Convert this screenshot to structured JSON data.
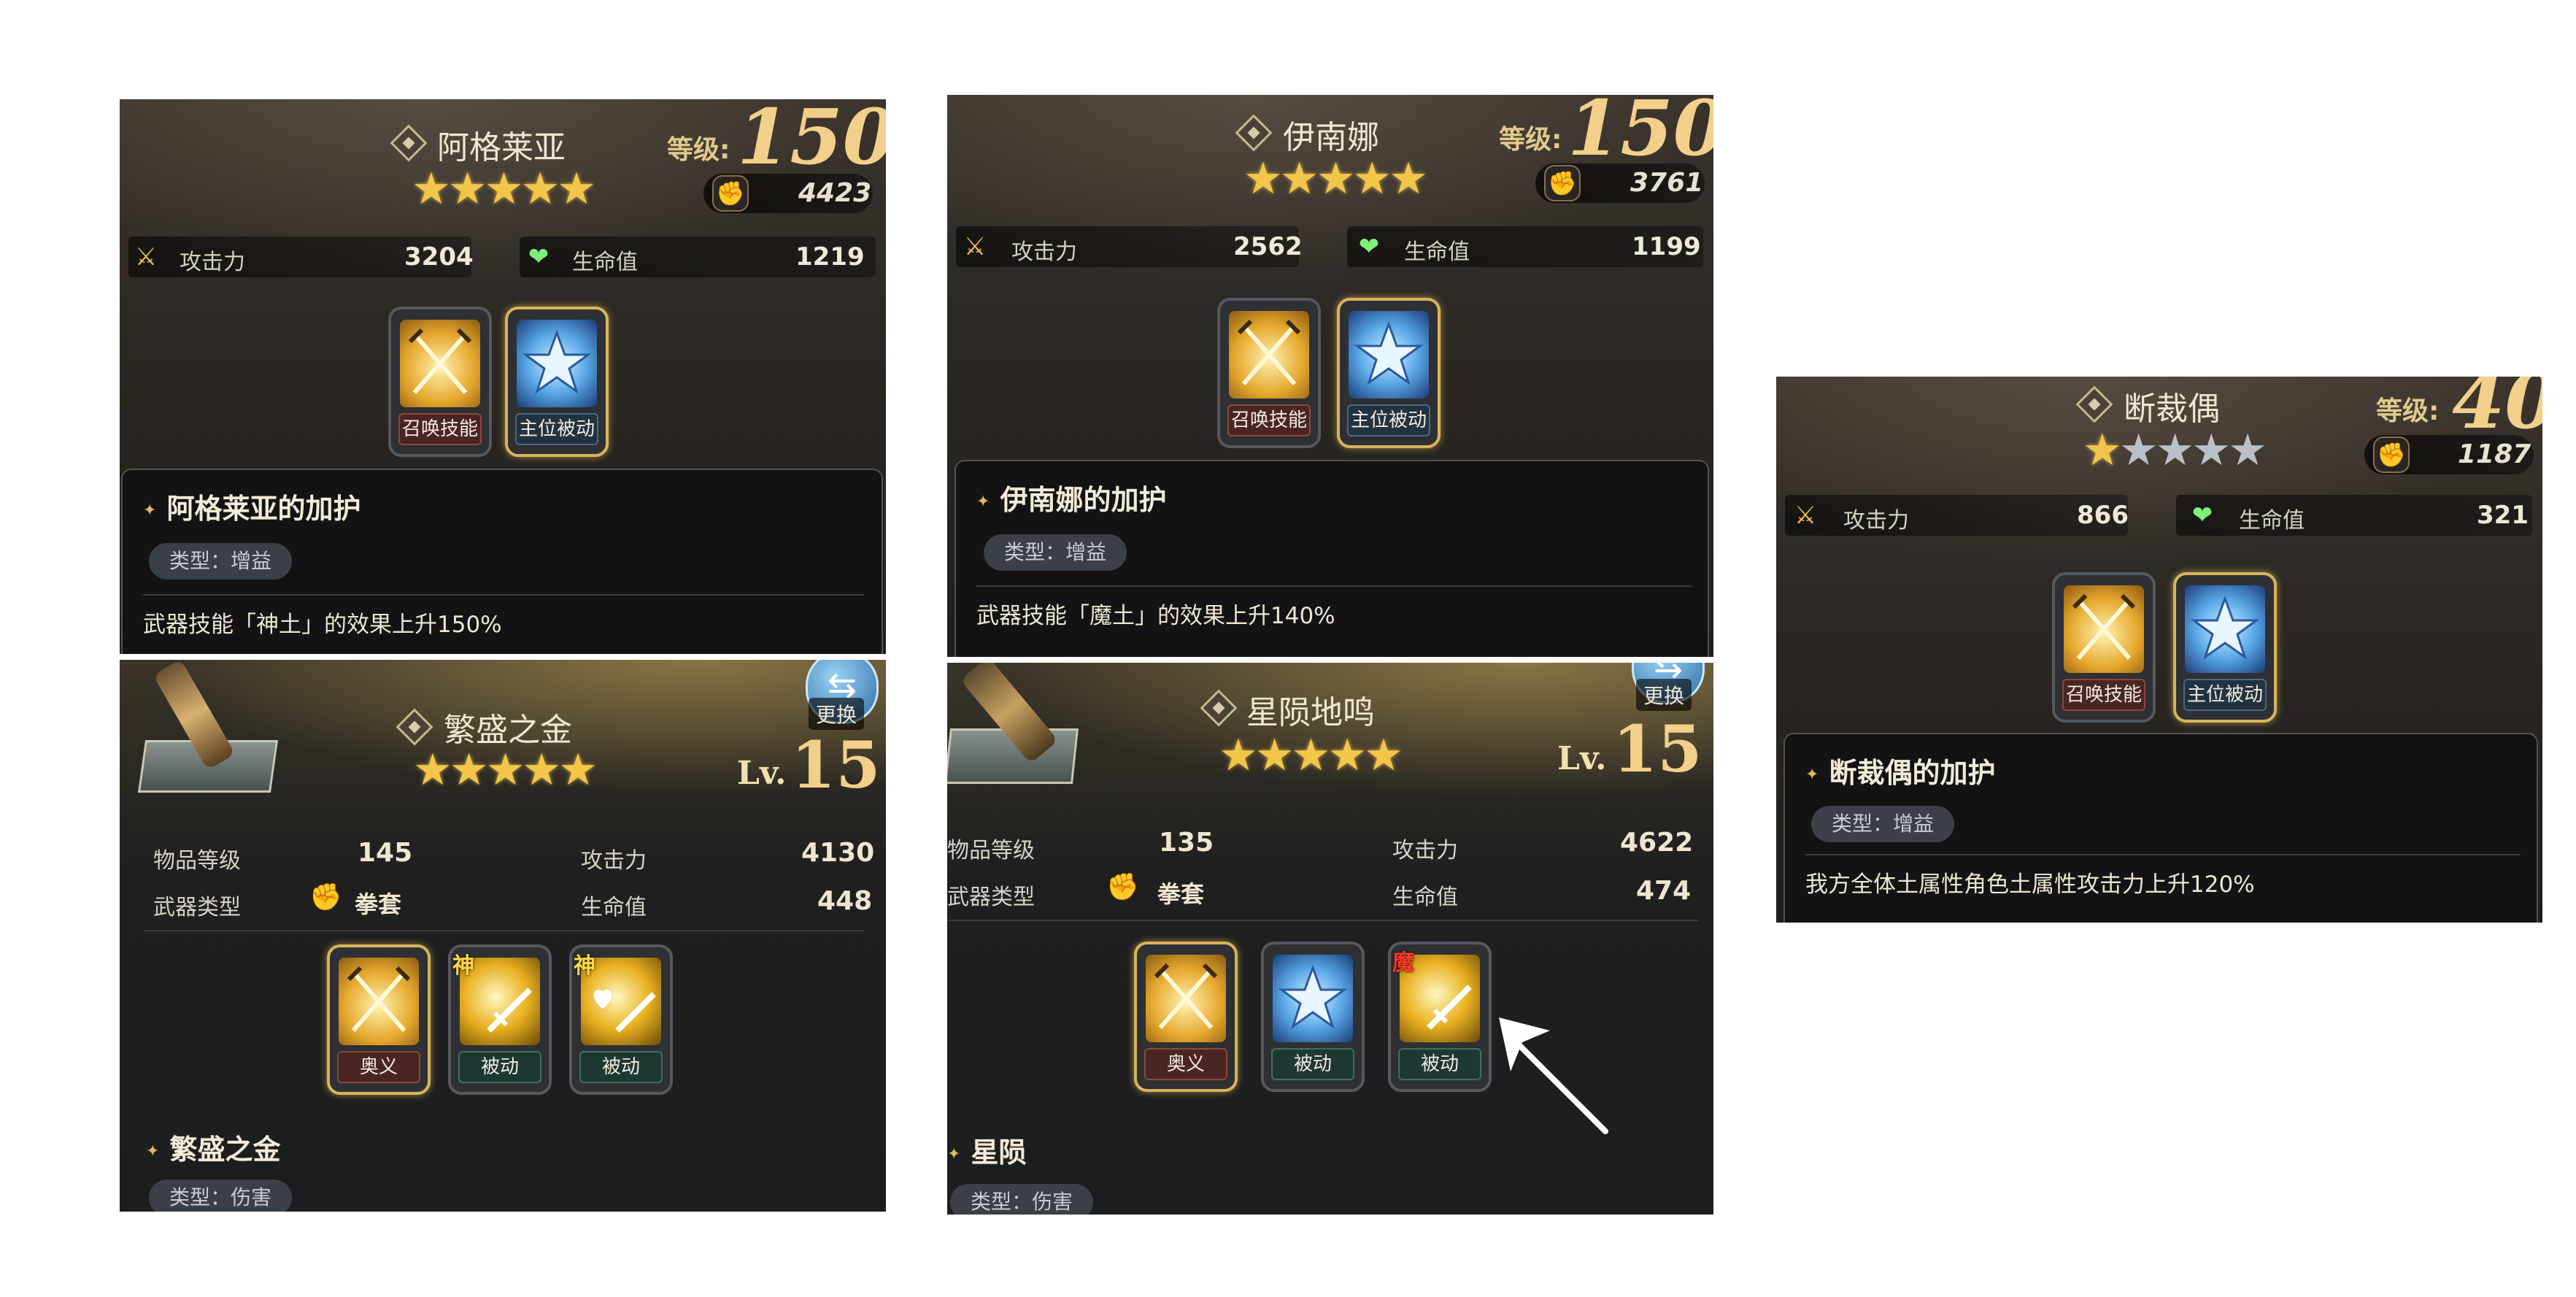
{
  "characters": [
    {
      "name": "阿格莱亚",
      "stars": 5,
      "level_label": "等级:",
      "level": "150",
      "power": "4423",
      "atk_label": "攻击力",
      "atk": "3204",
      "hp_label": "生命值",
      "hp": "1219",
      "skills": [
        {
          "label": "召唤技能",
          "icon": "crossed-swords-icon"
        },
        {
          "label": "主位被动",
          "icon": "star-emblem-icon"
        }
      ],
      "buff_title": "阿格莱亚的加护",
      "buff_type": "类型：增益",
      "buff_desc": "武器技能「神土」的效果上升150%"
    },
    {
      "name": "伊南娜",
      "stars": 5,
      "level_label": "等级:",
      "level": "150",
      "power": "3761",
      "atk_label": "攻击力",
      "atk": "2562",
      "hp_label": "生命值",
      "hp": "1199",
      "skills": [
        {
          "label": "召唤技能",
          "icon": "crossed-swords-icon"
        },
        {
          "label": "主位被动",
          "icon": "star-emblem-icon"
        }
      ],
      "buff_title": "伊南娜的加护",
      "buff_type": "类型：增益",
      "buff_desc": "武器技能「魔土」的效果上升140%"
    },
    {
      "name": "断裁偶",
      "stars": 1,
      "level_label": "等级:",
      "level": "40",
      "power": "1187",
      "atk_label": "攻击力",
      "atk": "866",
      "hp_label": "生命值",
      "hp": "321",
      "skills": [
        {
          "label": "召唤技能",
          "icon": "crossed-swords-icon"
        },
        {
          "label": "主位被动",
          "icon": "star-emblem-icon"
        }
      ],
      "buff_title": "断裁偶的加护",
      "buff_type": "类型：增益",
      "buff_desc": "我方全体土属性角色土属性攻击力上升120%"
    }
  ],
  "weapons": [
    {
      "name": "繁盛之金",
      "stars": 5,
      "swap_label": "更换",
      "lv_prefix": "Lv.",
      "lv": "15",
      "item_level_label": "物品等级",
      "item_level": "145",
      "atk_label": "攻击力",
      "atk": "4130",
      "type_label": "武器类型",
      "type": "拳套",
      "hp_label": "生命值",
      "hp": "448",
      "skills": [
        {
          "label": "奥义",
          "tag": ""
        },
        {
          "label": "被动",
          "tag": "神"
        },
        {
          "label": "被动",
          "tag": "神"
        }
      ],
      "title": "繁盛之金",
      "type_pill": "类型：伤害"
    },
    {
      "name": "星陨地鸣",
      "stars": 5,
      "swap_label": "更换",
      "lv_prefix": "Lv.",
      "lv": "15",
      "item_level_label": "物品等级",
      "item_level": "135",
      "atk_label": "攻击力",
      "atk": "4622",
      "type_label": "武器类型",
      "type": "拳套",
      "hp_label": "生命值",
      "hp": "474",
      "skills": [
        {
          "label": "奥义",
          "tag": ""
        },
        {
          "label": "被动",
          "tag": ""
        },
        {
          "label": "被动",
          "tag": "魔"
        }
      ],
      "title": "星陨",
      "type_pill": "类型：伤害"
    }
  ],
  "colors": {
    "gold": "#f3c64a",
    "panel_bg": "#201e1c",
    "accent_border": "#d8b35a"
  }
}
